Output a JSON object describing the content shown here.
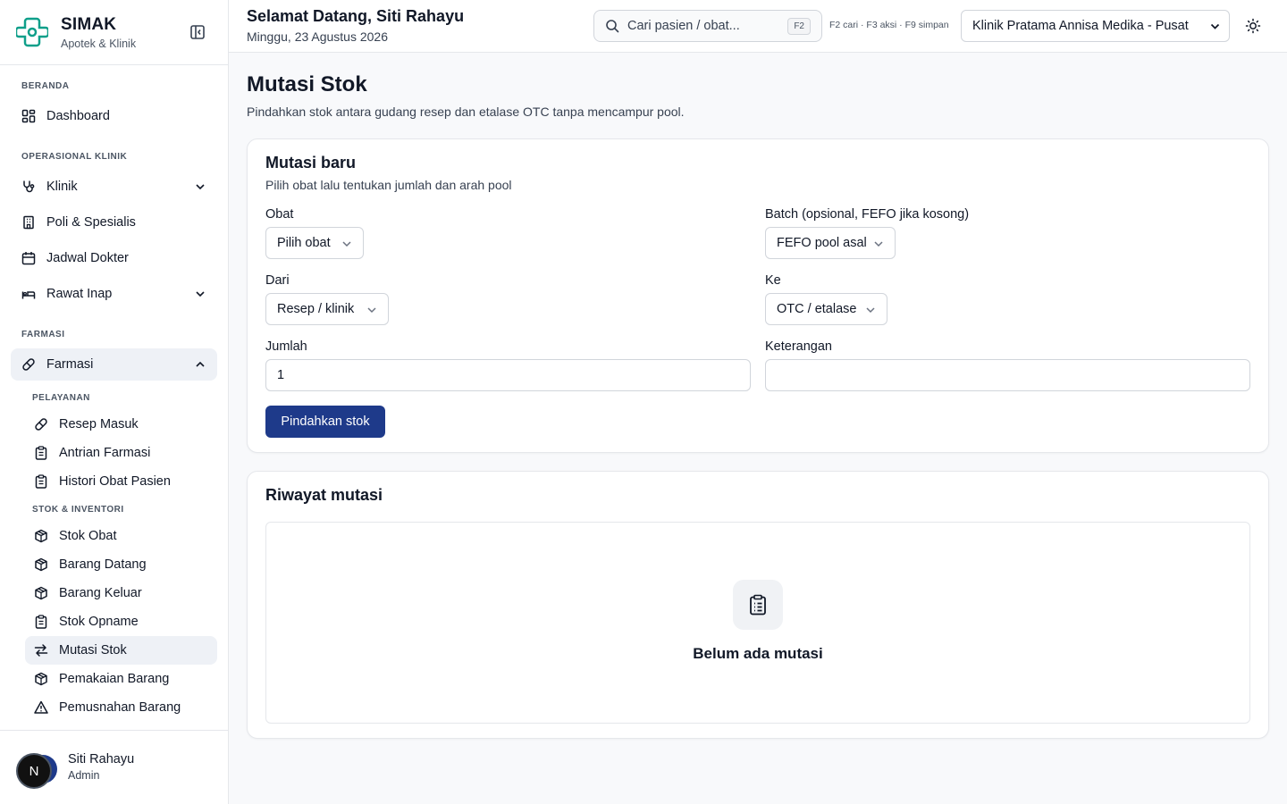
{
  "brand": {
    "title": "SIMAK",
    "subtitle": "Apotek & Klinik"
  },
  "header": {
    "greeting": "Selamat Datang, Siti Rahayu",
    "date": "Minggu, 23 Agustus 2026",
    "search_placeholder": "Cari pasien / obat...",
    "search_kbd": "F2",
    "shortcuts": "F2 cari · F3 aksi · F9 simpan",
    "clinic": "Klinik Pratama Annisa Medika - Pusat"
  },
  "sidebar": {
    "sections": {
      "beranda": "BERANDA",
      "operasional": "OPERASIONAL KLINIK",
      "farmasi": "FARMASI"
    },
    "items": {
      "dashboard": "Dashboard",
      "klinik": "Klinik",
      "poli": "Poli & Spesialis",
      "jadwal": "Jadwal Dokter",
      "rawat_inap": "Rawat Inap",
      "farmasi": "Farmasi"
    },
    "subsections": {
      "pelayanan": "PELAYANAN",
      "stok": "STOK & INVENTORI"
    },
    "sub_items": {
      "resep_masuk": "Resep Masuk",
      "antrian_farmasi": "Antrian Farmasi",
      "histori_obat": "Histori Obat Pasien",
      "stok_obat": "Stok Obat",
      "barang_datang": "Barang Datang",
      "barang_keluar": "Barang Keluar",
      "stok_opname": "Stok Opname",
      "mutasi_stok": "Mutasi Stok",
      "pemakaian_barang": "Pemakaian Barang",
      "pemusnahan_barang": "Pemusnahan Barang"
    },
    "user": {
      "initial": "N",
      "name": "Siti Rahayu",
      "role": "Admin"
    }
  },
  "page": {
    "title": "Mutasi Stok",
    "subtitle": "Pindahkan stok antara gudang resep dan etalase OTC tanpa mencampur pool."
  },
  "form": {
    "title": "Mutasi baru",
    "subtitle": "Pilih obat lalu tentukan jumlah dan arah pool",
    "obat_label": "Obat",
    "obat_value": "Pilih obat",
    "batch_label": "Batch (opsional, FEFO jika kosong)",
    "batch_value": "FEFO pool asal",
    "dari_label": "Dari",
    "dari_value": "Resep / klinik",
    "ke_label": "Ke",
    "ke_value": "OTC / etalase",
    "jumlah_label": "Jumlah",
    "jumlah_value": "1",
    "keterangan_label": "Keterangan",
    "keterangan_value": "",
    "submit_label": "Pindahkan stok"
  },
  "history": {
    "title": "Riwayat mutasi",
    "empty_text": "Belum ada mutasi"
  },
  "colors": {
    "primary": "#1e3a8a",
    "brand_green": "#0f9f8a",
    "active_bg": "#eef1f6"
  }
}
